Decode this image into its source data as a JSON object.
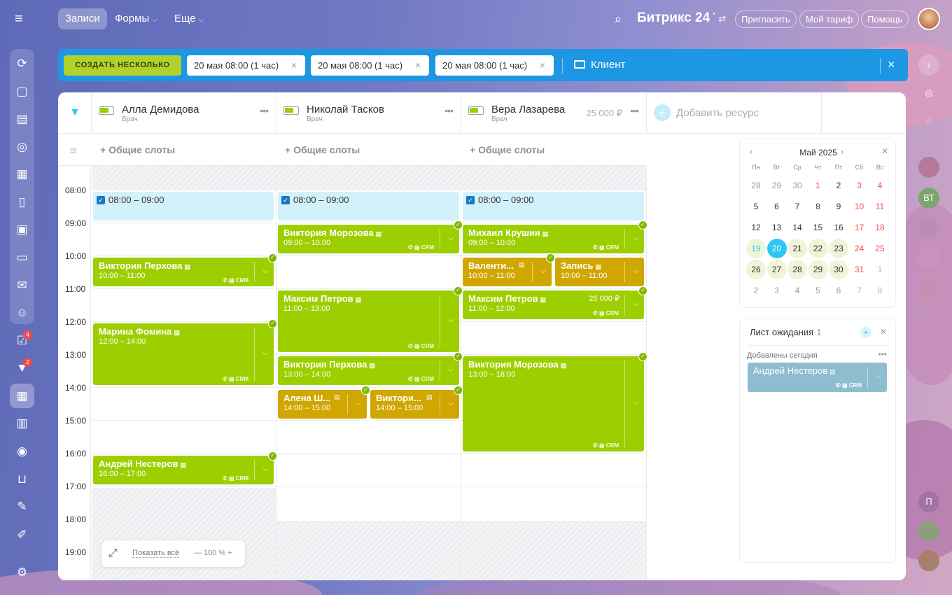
{
  "topbar": {
    "nav": [
      {
        "label": "Записи",
        "active": true
      },
      {
        "label": "Формы",
        "chevron": true
      },
      {
        "label": "Еще",
        "chevron": true
      }
    ],
    "brand": "Битрикс 24",
    "invite": "Пригласить",
    "tariff": "Мой тариф",
    "help": "Помощь"
  },
  "leftbar": {
    "badges": {
      "tasks": "4",
      "feed": "2"
    }
  },
  "action_bar": {
    "create_label": "СОЗДАТЬ НЕСКОЛЬКО",
    "chips": [
      "20 мая 08:00 (1 час)",
      "20 мая 08:00 (1 час)",
      "20 мая 08:00 (1 час)"
    ],
    "client_label": "Клиент"
  },
  "resources": [
    {
      "name": "Алла Демидова",
      "role": "Врач",
      "price": ""
    },
    {
      "name": "Николай Тасков",
      "role": "Врач",
      "price": ""
    },
    {
      "name": "Вера Лазарева",
      "role": "Врач",
      "price": "25 000 ₽"
    }
  ],
  "add_resource": "Добавить ресурс",
  "common_slots": "+ Общие слоты",
  "time_labels": [
    "08:00",
    "09:00",
    "10:00",
    "11:00",
    "12:00",
    "13:00",
    "14:00",
    "15:00",
    "16:00",
    "17:00",
    "18:00",
    "19:00"
  ],
  "available_slot": "08:00 – 09:00",
  "events": {
    "col1": [
      {
        "name": "Виктория Перхова",
        "time": "10:00 – 11:00"
      },
      {
        "name": "Марина Фомина",
        "time": "12:00 – 14:00"
      },
      {
        "name": "Андрей Нестеров",
        "time": "16:00 – 17:00"
      }
    ],
    "col2": [
      {
        "name": "Виктория Морозова",
        "time": "09:00 – 10:00"
      },
      {
        "name": "Максим Петров",
        "time": "11:00 – 13:00"
      },
      {
        "name": "Виктория Перхова",
        "time": "13:00 – 14:00"
      },
      {
        "name": "Алена Ш...",
        "time": "14:00 – 15:00"
      },
      {
        "name": "Виктори...",
        "time": "14:00 – 15:00"
      }
    ],
    "col3": [
      {
        "name": "Михаил Крушин",
        "time": "09:00 – 10:00"
      },
      {
        "name": "Валенти...",
        "time": "10:00 – 11:00"
      },
      {
        "name": "Запись",
        "time": "10:00 – 11:00"
      },
      {
        "name": "Максим Петров",
        "time": "11:00 – 12:00",
        "price": "25 000 ₽"
      },
      {
        "name": "Виктория Морозова",
        "time": "13:00 – 16:00"
      }
    ]
  },
  "event_icons_label": "✆ ▤ CRM",
  "zoom": {
    "show_all": "Показать всё",
    "level": "— 100 % +"
  },
  "calendar": {
    "month": "Май 2025",
    "weekdays": [
      "Пн",
      "Вт",
      "Ср",
      "Чт",
      "Пт",
      "Сб",
      "Вс"
    ],
    "weeks": [
      [
        "28",
        "29",
        "30",
        "1",
        "2",
        "3",
        "4"
      ],
      [
        "5",
        "6",
        "7",
        "8",
        "9",
        "10",
        "11"
      ],
      [
        "12",
        "13",
        "14",
        "15",
        "16",
        "17",
        "18"
      ],
      [
        "19",
        "20",
        "21",
        "22",
        "23",
        "24",
        "25"
      ],
      [
        "26",
        "27",
        "28",
        "29",
        "30",
        "31",
        "1"
      ],
      [
        "2",
        "3",
        "4",
        "5",
        "6",
        "7",
        "8"
      ]
    ],
    "today": "20"
  },
  "waitlist": {
    "title": "Лист ожидания",
    "count": "1",
    "subtitle": "Добавлены сегодня",
    "item": {
      "name": "Андрей Нестеров"
    }
  },
  "right_user_initial": "П",
  "colors": {
    "green": "#9dcf00",
    "yellow": "#d0a600",
    "blue": "#1d97e3",
    "accent": "#2fc6f6"
  }
}
